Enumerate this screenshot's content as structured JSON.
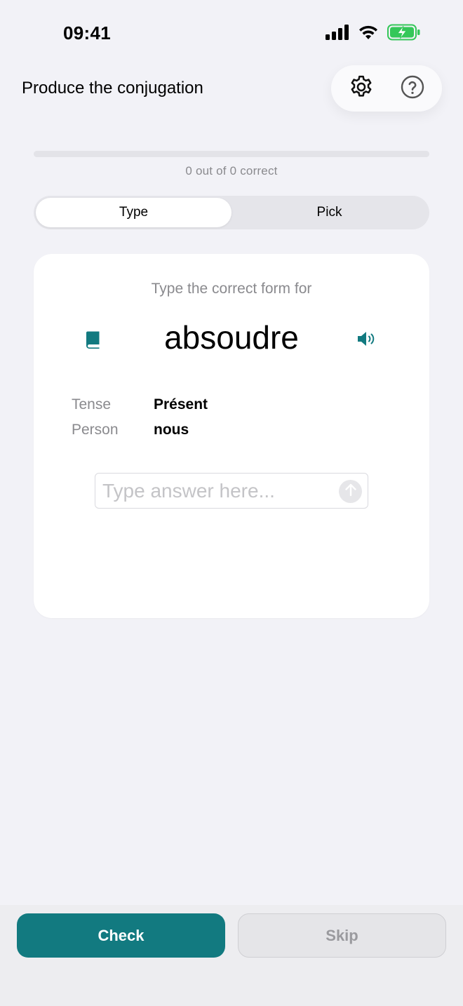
{
  "status_bar": {
    "time": "09:41",
    "icons": [
      "cellular-signal-icon",
      "wifi-icon",
      "battery-charging-icon"
    ]
  },
  "header": {
    "title": "Produce the conjugation",
    "actions": [
      "gear-icon",
      "question-icon"
    ]
  },
  "progress": {
    "label": "0 out of 0 correct",
    "fraction": 0
  },
  "mode_toggle": {
    "options": [
      "Type",
      "Pick"
    ],
    "selected": "Type"
  },
  "card": {
    "prompt": "Type the correct form for",
    "verb": "absoudre",
    "details": [
      {
        "label": "Tense",
        "value": "Présent"
      },
      {
        "label": "Person",
        "value": "nous"
      }
    ],
    "answer": {
      "placeholder": "Type answer here...",
      "value": ""
    }
  },
  "actions": {
    "check_label": "Check",
    "skip_label": "Skip"
  },
  "colors": {
    "accent": "#127a80",
    "background": "#f2f2f7",
    "battery_green": "#34c759"
  }
}
